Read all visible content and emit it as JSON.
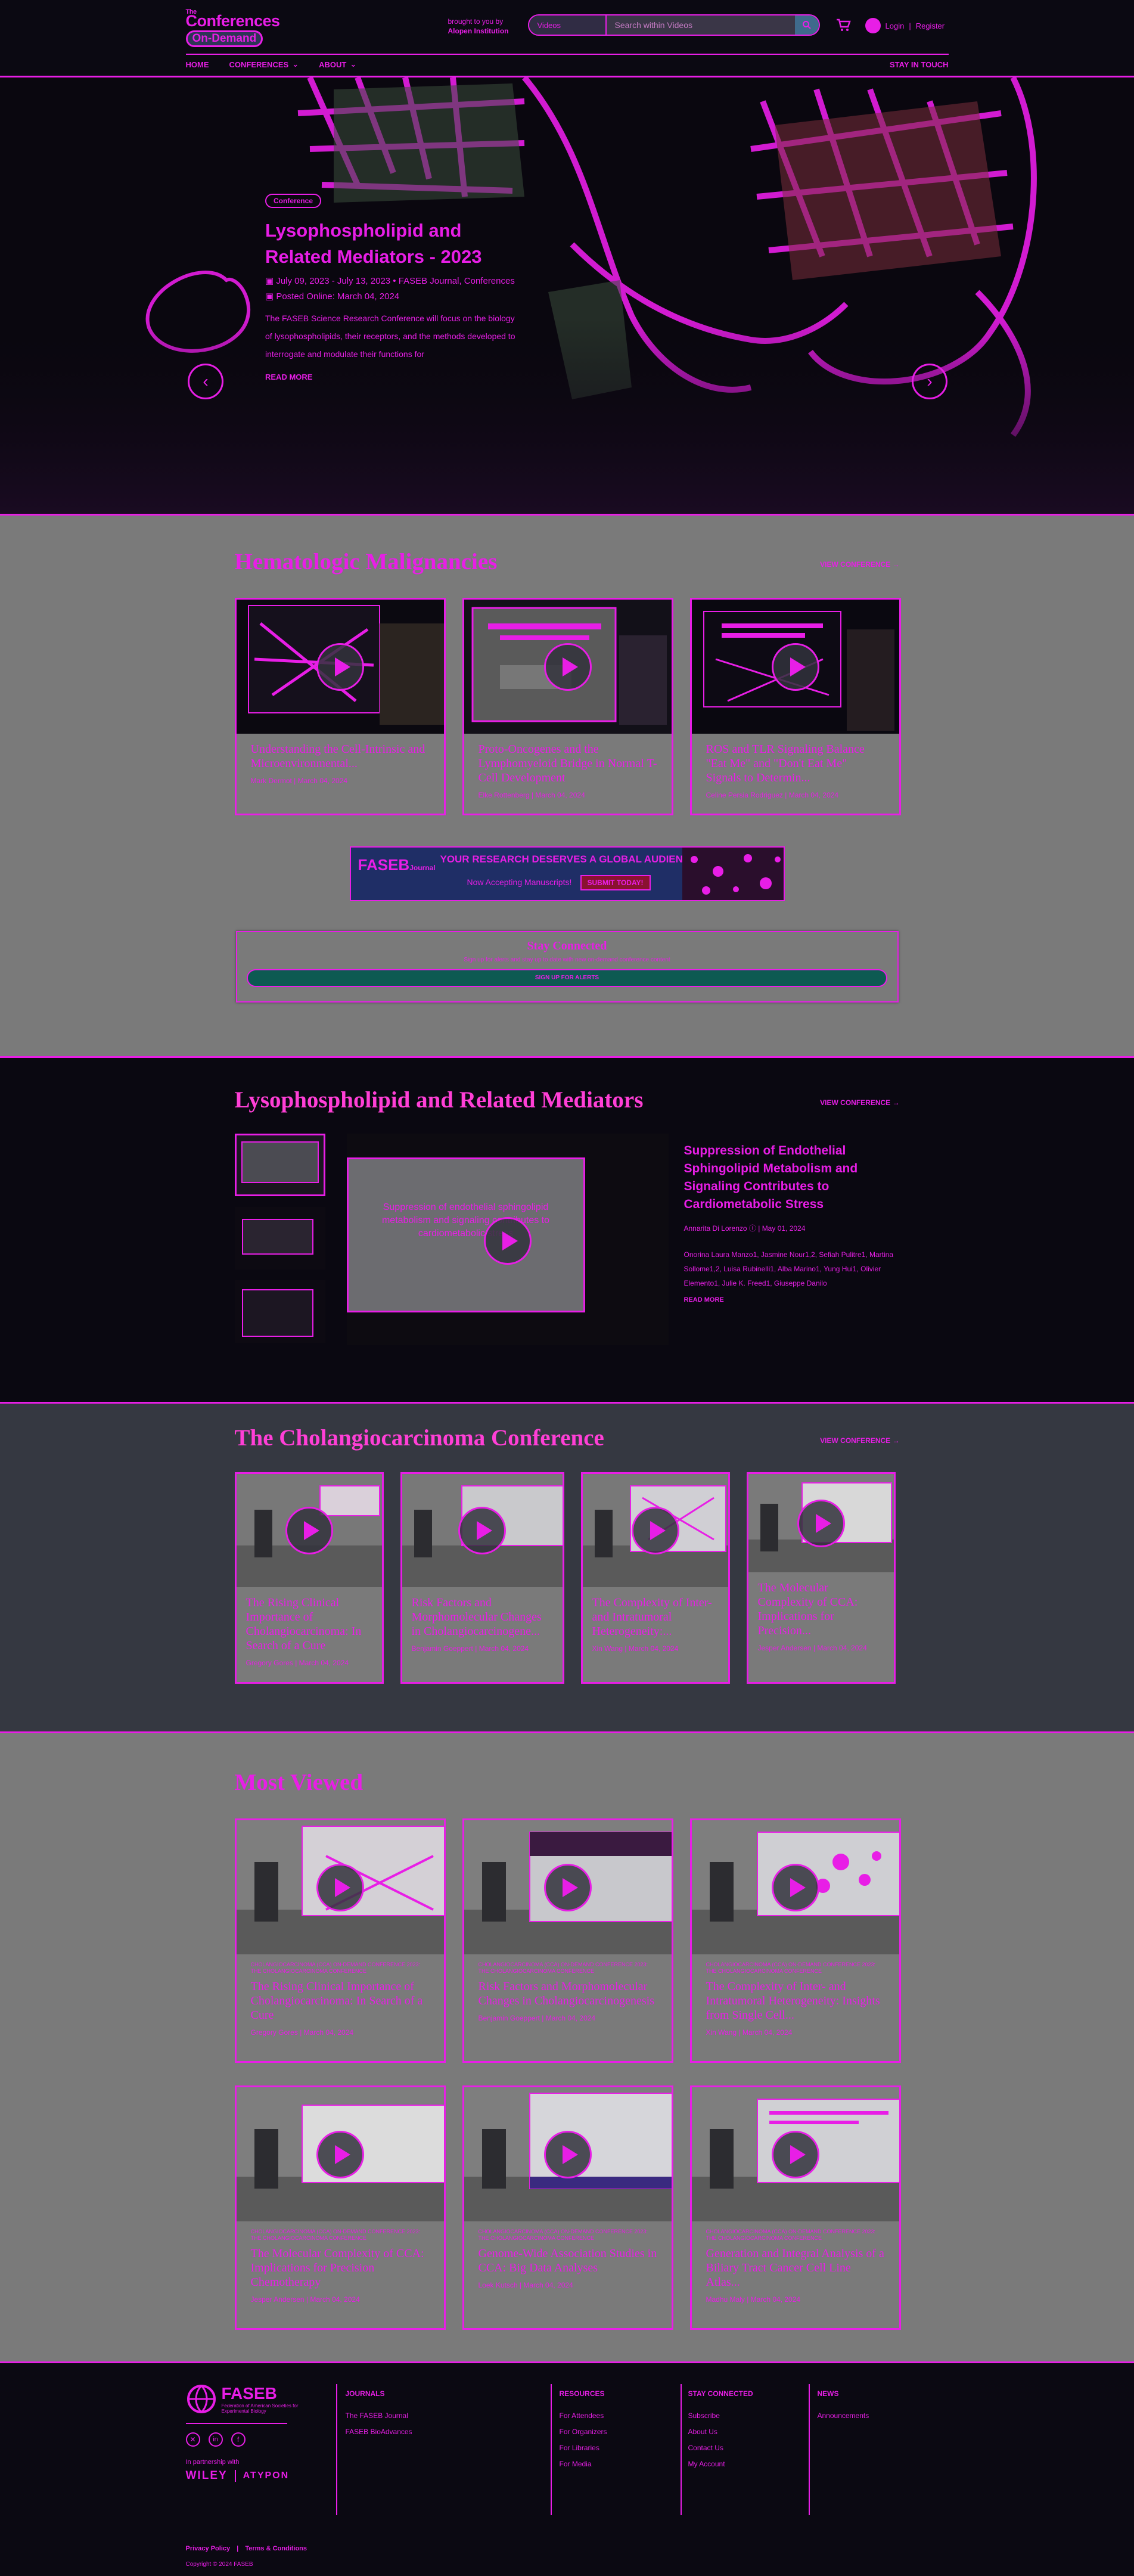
{
  "header": {
    "logo_top": "Conferences",
    "logo_the": "The",
    "logo_bottom": "On-Demand",
    "brought_line1": "brought to you by",
    "brought_line2": "Alopen Institution",
    "search_scope": "Videos",
    "search_placeholder": "Search within Videos",
    "login": "Login",
    "register": "Register",
    "nav": [
      "HOME",
      "CONFERENCES",
      "ABOUT"
    ],
    "stay_in_touch": "STAY IN TOUCH"
  },
  "hero": {
    "badge": "Conference",
    "title": "Lysophospholipid and Related Mediators - 2023",
    "dates": "July 09, 2023 - July 13, 2023",
    "journal": "FASEB Journal, Conferences",
    "posted": "Posted Online: March 04, 2024",
    "description": "The FASEB Science Research Conference will focus on the biology of lysophospholipids, their receptors, and the methods developed to interrogate and modulate their functions for",
    "read_more": "READ MORE",
    "prev": "‹",
    "next": "›"
  },
  "hematologic": {
    "title": "Hematologic Malignancies",
    "view_all": "VIEW CONFERENCE →",
    "cards": [
      {
        "title": "Understanding the Cell-Intrinsic and Microenvironmental...",
        "author": "Mark Dermot",
        "date": "March 04, 2024"
      },
      {
        "title": "Proto-Oncogenes and the Lymphomyeloid Bridge in Normal T-Cell Development",
        "author": "Elke Rottenberg",
        "date": "March 04, 2024"
      },
      {
        "title": "ROS and TLR Signaling Balance \"Eat Me\" and \"Don't Eat Me\" Signals to Determin...",
        "author": "Celine Persia Rodriguez",
        "date": "March 04, 2024"
      }
    ]
  },
  "banner": {
    "brand": "FASEB",
    "brand_sub": "Journal",
    "headline": "YOUR RESEARCH DESERVES A GLOBAL AUDIENCE!",
    "sub": "Now Accepting Manuscripts!",
    "cta": "SUBMIT TODAY!"
  },
  "stay_connected": {
    "title": "Stay Connected",
    "text": "Sign up for alerts and stay up to date with new on-demand conference content",
    "button": "SIGN UP FOR ALERTS"
  },
  "lysophospholipid": {
    "title": "Lysophospholipid and Related Mediators",
    "view_all": "VIEW CONFERENCE →",
    "feature_title": "Suppression of Endothelial Sphingolipid Metabolism and Signaling Contributes to Cardiometabolic Stress",
    "feature_author": "Annarita Di Lorenzo",
    "feature_date": "May 01, 2024",
    "feature_authors": "Onorina Laura Manzo1, Jasmine Nour1,2, Sefiah Pulitre1, Martina Sollome1,2, Luisa Rubinelli1, Alba Marino1, Yung Hui1, Olivier Elemento1, Julie K. Freed1, Giuseppe Danilo",
    "read_more": "READ MORE",
    "slide_line1": "Suppression of endothelial sphingolipid",
    "slide_line2": "metabolism and signaling contributes to",
    "slide_line3": "cardiometabolic stress"
  },
  "cholangio": {
    "title": "The Cholangiocarcinoma Conference",
    "view_all": "VIEW CONFERENCE →",
    "cards": [
      {
        "title": "The Rising Clinical Importance of Cholangiocarcinoma: In Search of a Cure",
        "author": "Gregory Gores",
        "date": "March 04, 2024"
      },
      {
        "title": "Risk Factors and Morphomolecular Changes in Cholangiocarcinogene...",
        "author": "Benjamin Goeppert",
        "date": "March 04, 2024"
      },
      {
        "title": "The Complexity of Inter- and Intratumoral Heterogeneity:...",
        "author": "Xin Wang",
        "date": "March 04, 2024"
      },
      {
        "title": "The Molecular Complexity of CCA: Implications for Precision...",
        "author": "Jesper Andersen",
        "date": "March 04, 2024"
      }
    ]
  },
  "most_viewed": {
    "title": "Most Viewed",
    "tag": "CHOLANGIOCARCINOMA (CCA) ON-DEMAND CONFERENCE 2023: THE CHOLANGIOCARCINOMA CONFERENCE",
    "cards": [
      {
        "title": "The Rising Clinical Importance of Cholangiocarcinoma: In Search of a Cure",
        "author": "Gregory Gores",
        "date": "March 04, 2024"
      },
      {
        "title": "Risk Factors and Morphomolecular Changes in Cholangiocarcinogenesis",
        "author": "Benjamin Goeppert",
        "date": "March 04, 2024"
      },
      {
        "title": "The Complexity of Inter- and Intratumoral Heterogeneity: Insights from Single Cell...",
        "author": "Xin Wang",
        "date": "March 04, 2024"
      },
      {
        "title": "The Molecular Complexity of CCA: Implications for Precision Chemotherapy",
        "author": "Jesper Andersen",
        "date": "March 04, 2024"
      },
      {
        "title": "Genome-Wide Association Studies in CCA: Big Data Analyses",
        "author": "Loek Kutsch",
        "date": "March 04, 2024"
      },
      {
        "title": "Generation and Integral Analysis of a Biliary Tract Cancer Cell Line Atlas...",
        "author": "Madhu Maly",
        "date": "March 04, 2024"
      }
    ]
  },
  "footer": {
    "brand": "FASEB",
    "brand_sub": "Federation of American Societies for Experimental Biology",
    "partnership": "In partnership with",
    "partners": [
      "WILEY",
      "ATYPON"
    ],
    "journals_hd": "JOURNALS",
    "journals": [
      "The FASEB Journal",
      "FASEB BioAdvances"
    ],
    "resources_hd": "RESOURCES",
    "resources": [
      "For Attendees",
      "For Organizers",
      "For Libraries",
      "For Media"
    ],
    "stay_hd": "STAY CONNECTED",
    "stay": [
      "Subscribe",
      "About Us",
      "Contact Us",
      "My Account"
    ],
    "news_hd": "NEWS",
    "news": [
      "Announcements"
    ],
    "privacy": "Privacy Policy",
    "terms": "Terms & Conditions",
    "copyright": "Copyright © 2024 FASEB"
  },
  "colors": {
    "accent": "#e81ee6",
    "page_dark": "#0a0811",
    "section_gray": "#7a7a7a",
    "section_slate": "#353841"
  }
}
